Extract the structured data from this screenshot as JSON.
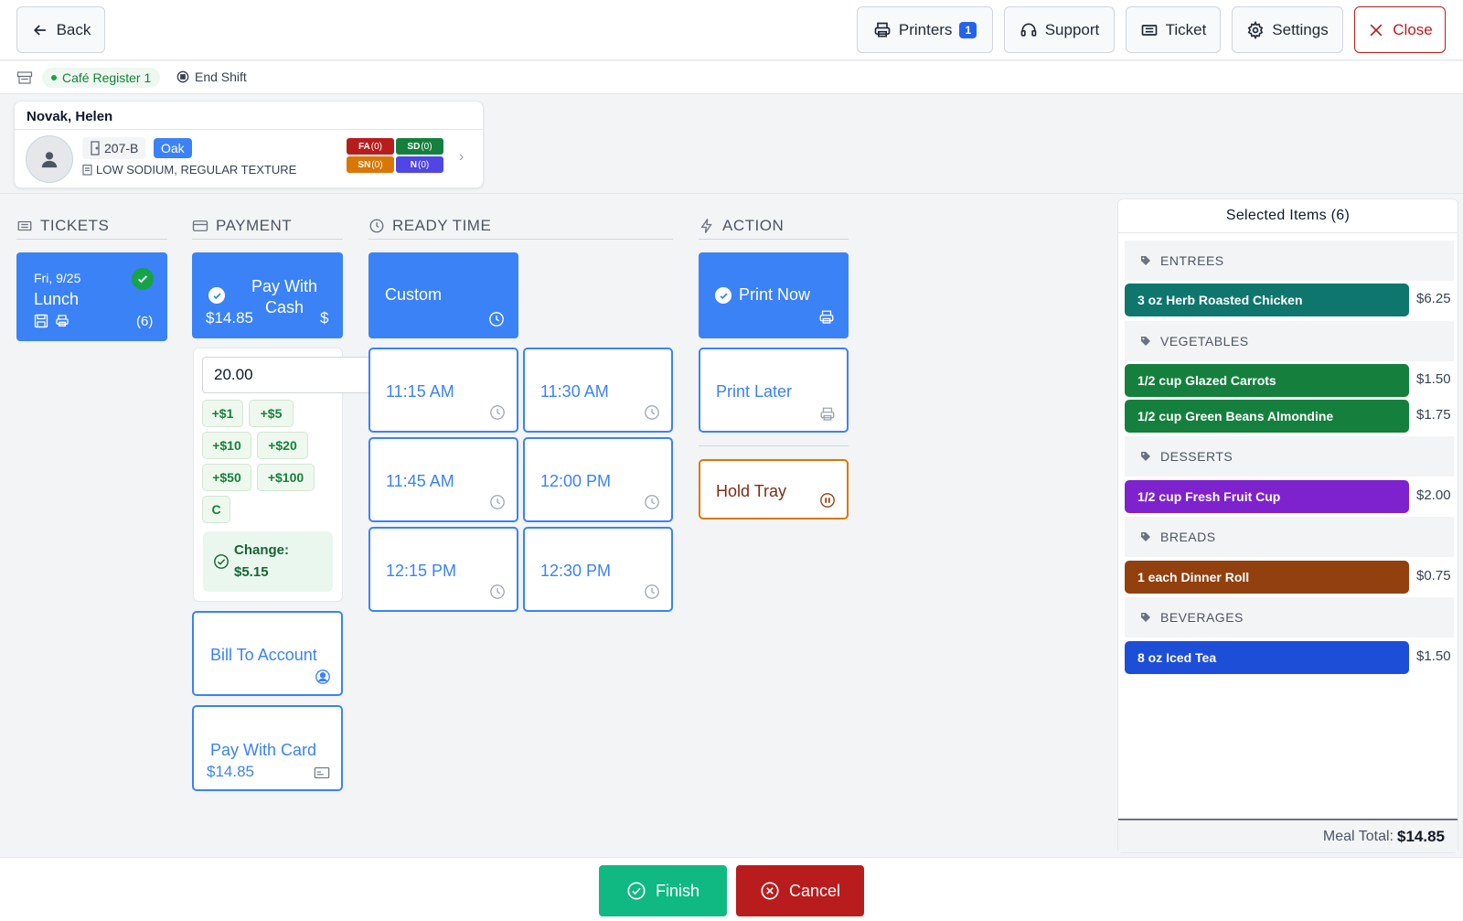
{
  "topbar": {
    "back_label": "Back",
    "printers_label": "Printers",
    "printers_count": "1",
    "support_label": "Support",
    "ticket_label": "Ticket",
    "settings_label": "Settings",
    "close_label": "Close"
  },
  "subbar": {
    "register_label": "Café Register 1",
    "end_shift_label": "End Shift"
  },
  "patient": {
    "name": "Novak, Helen",
    "room": "207-B",
    "unit": "Oak",
    "diet": "LOW SODIUM, REGULAR TEXTURE",
    "tags": [
      {
        "code": "FA",
        "count": "(0)",
        "color": "#b91c1c"
      },
      {
        "code": "SD",
        "count": "(0)",
        "color": "#15803d"
      },
      {
        "code": "SN",
        "count": "(0)",
        "color": "#d97706"
      },
      {
        "code": "N",
        "count": "(0)",
        "color": "#4f46e5"
      }
    ]
  },
  "sections": {
    "tickets": "TICKETS",
    "payment": "PAYMENT",
    "ready_time": "READY TIME",
    "action": "ACTION"
  },
  "ticket": {
    "date": "Fri, 9/25",
    "meal": "Lunch",
    "count": "(6)"
  },
  "payment": {
    "cash_label": "Pay With Cash",
    "cash_amount": "$14.85",
    "cash_symbol": "$",
    "input_value": "20.00",
    "quick_amounts": [
      "+$1",
      "+$5",
      "+$10",
      "+$20",
      "+$50",
      "+$100",
      "C"
    ],
    "change_label": "Change:",
    "change_value": "$5.15",
    "bill_label": "Bill To Account",
    "card_label": "Pay With Card",
    "card_amount": "$14.85"
  },
  "ready_time": {
    "custom_label": "Custom",
    "times": [
      "11:15 AM",
      "11:30 AM",
      "11:45 AM",
      "12:00 PM",
      "12:15 PM",
      "12:30 PM"
    ]
  },
  "action": {
    "print_now": "Print Now",
    "print_later": "Print Later",
    "hold_tray": "Hold Tray"
  },
  "selected": {
    "title": "Selected Items (6)",
    "categories": [
      {
        "name": "ENTREES",
        "items": [
          {
            "name": "3 oz Herb Roasted Chicken",
            "price": "$6.25",
            "color": "#0f766e"
          }
        ]
      },
      {
        "name": "VEGETABLES",
        "items": [
          {
            "name": "1/2 cup Glazed Carrots",
            "price": "$1.50",
            "color": "#15803d"
          },
          {
            "name": "1/2 cup Green Beans Almondine",
            "price": "$1.75",
            "color": "#15803d"
          }
        ]
      },
      {
        "name": "DESSERTS",
        "items": [
          {
            "name": "1/2 cup Fresh Fruit Cup",
            "price": "$2.00",
            "color": "#7e22ce"
          }
        ]
      },
      {
        "name": "BREADS",
        "items": [
          {
            "name": "1 each Dinner Roll",
            "price": "$0.75",
            "color": "#92400e"
          }
        ]
      },
      {
        "name": "BEVERAGES",
        "items": [
          {
            "name": "8 oz Iced Tea",
            "price": "$1.50",
            "color": "#1d4ed8"
          }
        ]
      }
    ],
    "total_label": "Meal Total:",
    "total_value": "$14.85"
  },
  "bottom": {
    "finish_label": "Finish",
    "cancel_label": "Cancel"
  },
  "colors": {
    "primary": "#3b82f6",
    "success": "#10b981",
    "danger": "#b91c1c",
    "hold": "#d97706"
  }
}
